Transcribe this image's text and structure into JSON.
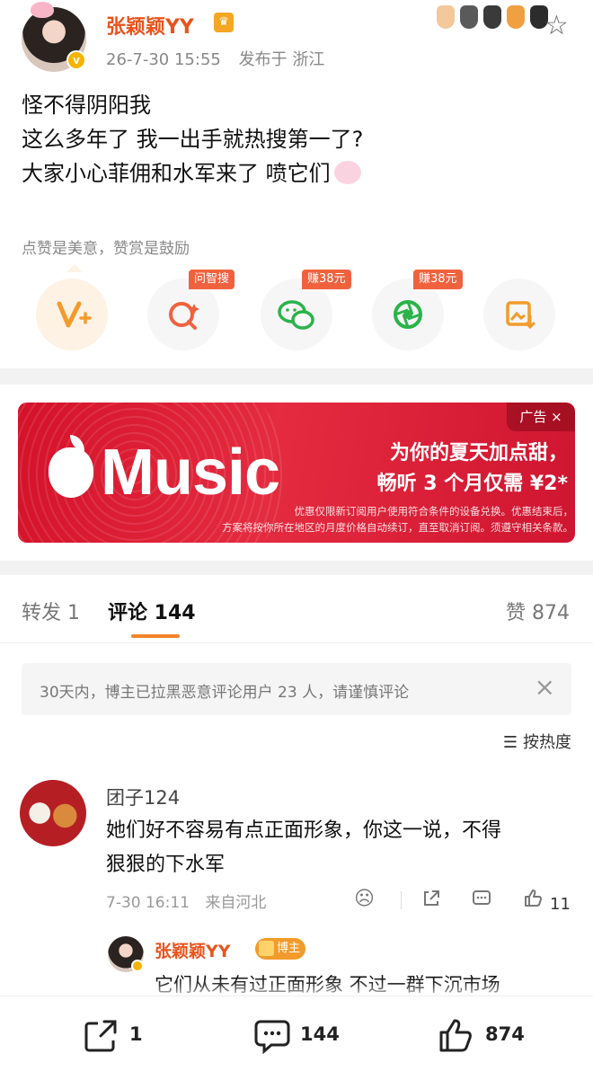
{
  "post": {
    "author": "张颖颖YY",
    "date": "26-7-30 15:55",
    "location": "发布于 浙江",
    "lines": [
      "怪不得阴阳我",
      "这么多年了 我一出手就热搜第一了?",
      "大家小心菲佣和水军来了 喷它们"
    ]
  },
  "tips": {
    "label": "点赞是美意，赞赏是鼓励",
    "buttons": [
      {
        "icon": "v-plus-icon",
        "badge": ""
      },
      {
        "icon": "search-sparkle-icon",
        "badge": "问智搜"
      },
      {
        "icon": "wechat-icon",
        "badge": "赚38元"
      },
      {
        "icon": "moments-icon",
        "badge": "赚38元"
      },
      {
        "icon": "save-image-icon",
        "badge": ""
      }
    ]
  },
  "ad": {
    "brand": "Music",
    "headline_1": "为你的夏天加点甜，",
    "headline_2": "畅听 3 个月仅需 ¥2*",
    "fine_1": "优惠仅限新订阅用户使用符合条件的设备兑换。优惠结束后，",
    "fine_2": "方案将按你所在地区的月度价格自动续订，直至取消订阅。须遵守相关条款。",
    "tag": "广告 ×"
  },
  "tabs": {
    "repost": "转发 1",
    "comments": "评论 144",
    "likes": "赞 874"
  },
  "notice": {
    "text": "30天内，博主已拉黑恶意评论用户 23 人，请谨慎评论",
    "close": "×"
  },
  "sort": {
    "label": "按热度"
  },
  "comment": {
    "user": "团子124",
    "line_1": "她们好不容易有点正面形象，你这一说，不得",
    "line_2": "狠狠的下水军",
    "date": "7-30 16:11",
    "location": "来自河北",
    "likes": "11"
  },
  "reply": {
    "user": "张颖颖YY",
    "badge": "博主",
    "text": "它们从未有过正面形象 不过一群下沉市场"
  },
  "bottom_bar": {
    "reposts": "1",
    "comments": "144",
    "likes": "874"
  },
  "colors": {
    "accent": "#e8541c",
    "tab_underline": "#f2842a",
    "ad_red": "#d4122a",
    "badge_red": "#f0623e"
  }
}
